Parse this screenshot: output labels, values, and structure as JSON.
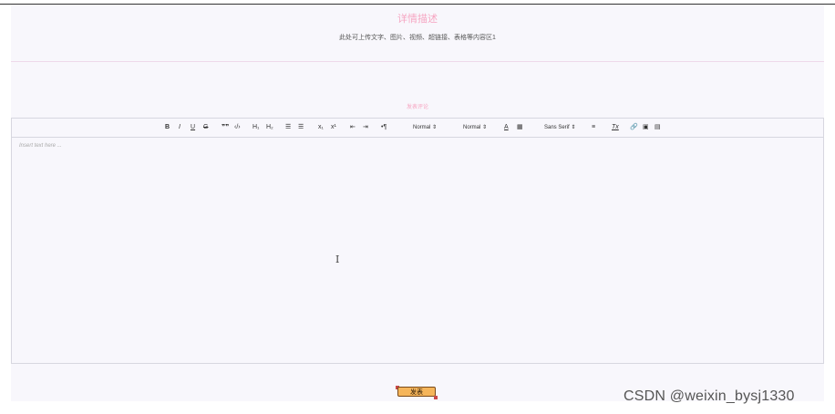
{
  "detail": {
    "title": "详情描述",
    "content": "此处可上传文字、图片、视频、超链接、表格等内容区1"
  },
  "comment": {
    "title": "发表评论",
    "placeholder": "Insert text here ...",
    "submit_label": "发表"
  },
  "toolbar": {
    "bold": "B",
    "italic": "I",
    "underline": "U",
    "strike": "G",
    "blockquote": "❞❞",
    "code": "‹/›",
    "header1": "H₁",
    "header2": "H₂",
    "ordered_list": "☰",
    "bullet_list": "☰",
    "subscript": "x₁",
    "superscript": "x¹",
    "indent_dec": "⇤",
    "indent_inc": "⇥",
    "direction": "•¶",
    "size": "Normal ⇕",
    "header": "Normal ⇕",
    "color": "A",
    "background": "▦",
    "font": "Sans Serif ⇕",
    "align": "≡",
    "clean": "Tx",
    "link": "🔗",
    "image": "▣",
    "video": "▤"
  },
  "watermark": "CSDN @weixin_bysj1330",
  "colors": {
    "accent_pink": "#f6a6c2",
    "button_orange": "#f5b55b",
    "page_bg": "#f8f7fc"
  }
}
